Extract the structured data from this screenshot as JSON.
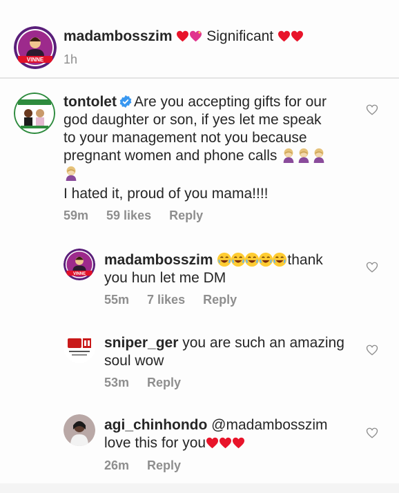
{
  "caption": {
    "username": "madambosszim",
    "text": "Significant",
    "time": "1h",
    "avatar_label": "VINNE"
  },
  "comments": [
    {
      "username": "tontolet",
      "verified": true,
      "text_line1": "Are you accepting gifts for our",
      "text_line2": "god daughter or son, if yes let me speak",
      "text_line3": "to your management not you because",
      "text_line4": "pregnant women and phone calls",
      "text_line5": "I hated it, proud of you mama!!!!",
      "time": "59m",
      "likes": "59 likes",
      "reply": "Reply"
    },
    {
      "username": "madambosszim",
      "text_line1": "thank",
      "text_line2": "you hun let me DM",
      "time": "55m",
      "likes": "7 likes",
      "reply": "Reply",
      "avatar_label": "VINNE"
    },
    {
      "username": "sniper_ger",
      "text_line1": "you are such an amazing",
      "text_line2": "soul wow",
      "time": "53m",
      "reply": "Reply"
    },
    {
      "username": "agi_chinhondo",
      "mention": "@madambosszim",
      "text_line2": "love this for you",
      "time": "26m",
      "reply": "Reply"
    }
  ],
  "colors": {
    "heart": "#e8142a",
    "verified": "#3897f0",
    "meta": "#8e8e8e",
    "text": "#262626"
  },
  "icons": [
    "red-heart-icon",
    "pink-sparkle-heart-icon",
    "verified-badge-icon",
    "facepalm-emoji-icon",
    "laughing-emoji-icon",
    "like-heart-outline-icon"
  ]
}
